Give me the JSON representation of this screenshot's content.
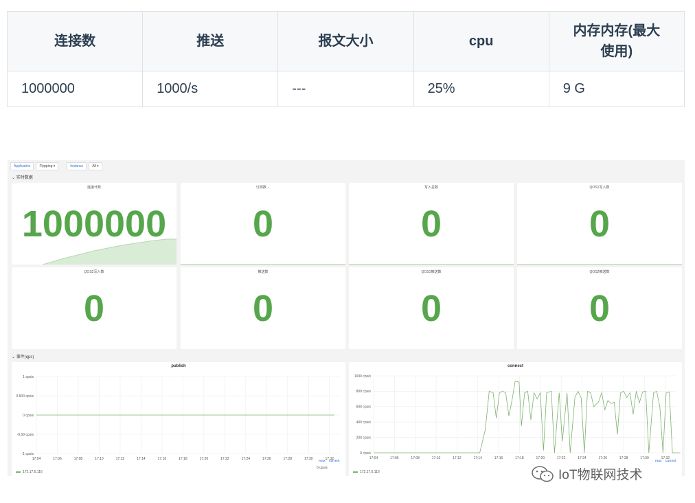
{
  "table": {
    "headers": [
      "连接数",
      "推送",
      "报文大小",
      "cpu",
      "内存内存(最大\n使用)"
    ],
    "header_line1": "内存内存(最大",
    "header_line2": "使用)",
    "row": [
      "1000000",
      "1000/s",
      "---",
      "25%",
      "9 G"
    ]
  },
  "dashboard": {
    "toolbar": {
      "app_label": "Application",
      "app_value": "Flypping ▾",
      "instance_label": "Instance",
      "instance_value": "All ▾"
    },
    "row1_title": "⌄ 实时数据",
    "row2_title": "⌄ 事件(qps)",
    "stats": [
      {
        "title": "连接计数",
        "value": "1000000"
      },
      {
        "title": "订阅数 ⌄",
        "value": "0"
      },
      {
        "title": "写入总数",
        "value": "0"
      },
      {
        "title": "QOS1写入数",
        "value": "0"
      },
      {
        "title": "QOS2写入数",
        "value": "0"
      },
      {
        "title": "推送数",
        "value": "0"
      },
      {
        "title": "QOS1推送数",
        "value": "0"
      },
      {
        "title": "QOS2推送数",
        "value": "0"
      }
    ],
    "colors": {
      "stat_green": "#56a64b",
      "series_green": "#7eb26d",
      "link_blue": "#3274d9"
    },
    "graphs": [
      {
        "title": "publish",
        "legend_series": "172.17.6.116",
        "legend_max": "max",
        "legend_current": "current",
        "legend_current_value": "0 cps/s"
      },
      {
        "title": "connect",
        "legend_series": "172.17.6.116",
        "legend_max": "max",
        "legend_current": "current"
      }
    ]
  },
  "chart_data": [
    {
      "type": "line",
      "title": "publish",
      "x": [
        "17:04",
        "17:06",
        "17:08",
        "17:10",
        "17:12",
        "17:14",
        "17:16",
        "17:18",
        "17:20",
        "17:22",
        "17:24",
        "17:26",
        "17:28",
        "17:30",
        "17:32"
      ],
      "yticks": [
        "1 cps/s",
        "0.500 cps/s",
        "0 cps/s",
        "-0.50 cps/s",
        "-1 cps/s"
      ],
      "ylim": [
        -1,
        1
      ],
      "series": [
        {
          "name": "172.17.6.116",
          "values": [
            0,
            0,
            0,
            0,
            0,
            0,
            0,
            0,
            0,
            0,
            0,
            0,
            0,
            0,
            0
          ]
        }
      ]
    },
    {
      "type": "line",
      "title": "connect",
      "x": [
        "17:04",
        "17:06",
        "17:08",
        "17:10",
        "17:12",
        "17:14",
        "17:16",
        "17:18",
        "17:20",
        "17:22",
        "17:24",
        "17:26",
        "17:28",
        "17:30",
        "17:32"
      ],
      "yticks": [
        "1000 cps/s",
        "800 cps/s",
        "600 cps/s",
        "400 cps/s",
        "200 cps/s",
        "0 cps/s"
      ],
      "ylim": [
        0,
        1000
      ],
      "series": [
        {
          "name": "172.17.6.116",
          "points": [
            [
              0,
              0
            ],
            [
              5,
              0
            ],
            [
              10,
              0
            ],
            [
              13.5,
              0
            ],
            [
              14.2,
              300
            ],
            [
              14.7,
              800
            ],
            [
              15.2,
              780
            ],
            [
              15.6,
              450
            ],
            [
              16.0,
              780
            ],
            [
              16.4,
              800
            ],
            [
              16.8,
              780
            ],
            [
              17.2,
              480
            ],
            [
              17.6,
              680
            ],
            [
              18.0,
              930
            ],
            [
              18.5,
              920
            ],
            [
              18.8,
              350
            ],
            [
              19.2,
              780
            ],
            [
              19.6,
              800
            ],
            [
              20.0,
              430
            ],
            [
              20.4,
              780
            ],
            [
              20.8,
              700
            ],
            [
              21.2,
              780
            ],
            [
              21.6,
              30
            ],
            [
              22.0,
              780
            ],
            [
              22.6,
              800
            ],
            [
              23.0,
              0
            ],
            [
              23.6,
              780
            ],
            [
              24.0,
              150
            ],
            [
              24.6,
              780
            ],
            [
              25.0,
              0
            ],
            [
              25.6,
              720
            ],
            [
              26.0,
              800
            ],
            [
              26.4,
              710
            ],
            [
              26.8,
              0
            ],
            [
              27.2,
              800
            ],
            [
              27.6,
              780
            ],
            [
              28.0,
              600
            ],
            [
              28.6,
              660
            ],
            [
              29.0,
              780
            ],
            [
              29.4,
              560
            ],
            [
              29.8,
              680
            ],
            [
              30.2,
              640
            ],
            [
              30.6,
              660
            ],
            [
              31.0,
              240
            ],
            [
              31.4,
              780
            ],
            [
              31.8,
              800
            ],
            [
              32.2,
              720
            ],
            [
              32.6,
              780
            ],
            [
              33.0,
              500
            ],
            [
              33.4,
              800
            ],
            [
              33.8,
              650
            ],
            [
              34.2,
              790
            ],
            [
              34.6,
              800
            ],
            [
              35.0,
              0
            ],
            [
              35.6,
              780
            ],
            [
              36.0,
              800
            ],
            [
              36.4,
              600
            ],
            [
              36.8,
              0
            ],
            [
              37.2,
              780
            ],
            [
              37.6,
              790
            ],
            [
              38.0,
              0
            ],
            [
              38.6,
              0
            ],
            [
              39.0,
              0
            ]
          ]
        }
      ]
    }
  ],
  "watermark": "IoT物联网技术"
}
